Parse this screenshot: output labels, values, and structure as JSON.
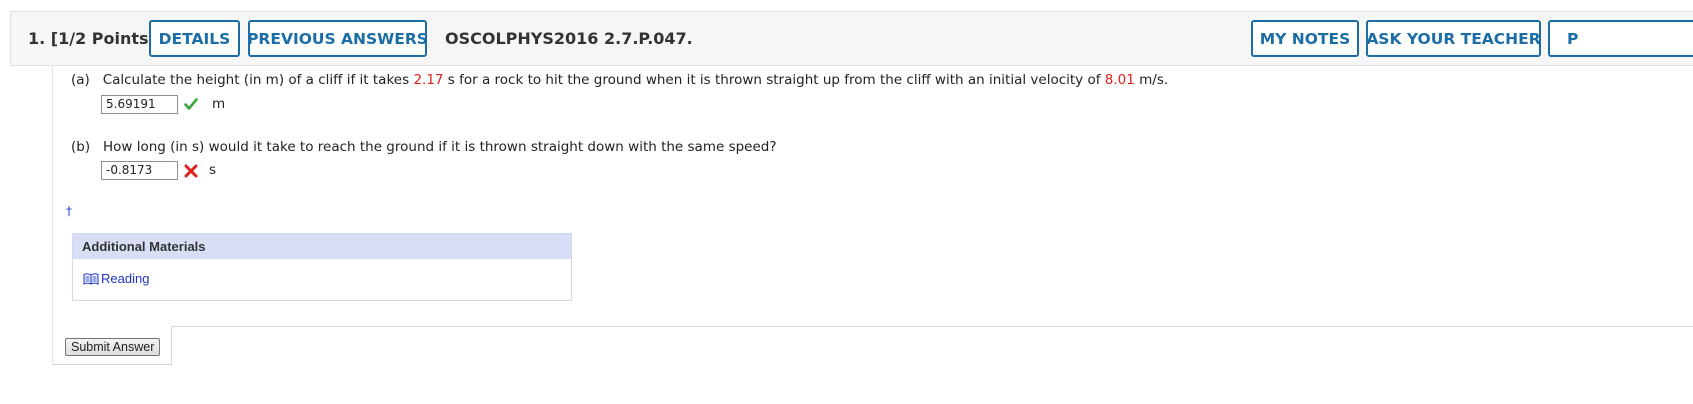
{
  "header": {
    "question_number": "1.",
    "points": "[1/2 Points]",
    "details_label": "DETAILS",
    "previous_answers_label": "PREVIOUS ANSWERS",
    "question_code": "OSCOLPHYS2016 2.7.P.047.",
    "my_notes_label": "MY NOTES",
    "ask_teacher_label": "ASK YOUR TEACHER",
    "cut_off_label": "P"
  },
  "part_a": {
    "label": "(a)",
    "text_1": "Calculate the height (in m) of a cliff if it takes",
    "time_value": "2.17",
    "text_2": "s for a rock to hit the ground when it is thrown straight up from the cliff with an initial velocity of",
    "velocity_value": "8.01",
    "text_3": "m/s.",
    "answer_value": "5.69191",
    "unit": "m",
    "status_icon": "check-icon"
  },
  "part_b": {
    "label": "(b)",
    "text": "How long (in s) would it take to reach the ground if it is thrown straight down with the same speed?",
    "answer_value": "-0.8173",
    "unit": "s",
    "status_icon": "cross-icon"
  },
  "footnote_symbol": "†",
  "additional_materials": {
    "title": "Additional Materials",
    "link_label": "Reading",
    "link_icon": "book-icon"
  },
  "submit_label": "Submit Answer",
  "colors": {
    "accent_blue": "#1b6da5",
    "value_red": "#e0201d",
    "correct_green": "#3aa53a",
    "incorrect_red": "#e0201d",
    "materials_header": "#d8def5",
    "link_blue": "#1f35c4"
  }
}
